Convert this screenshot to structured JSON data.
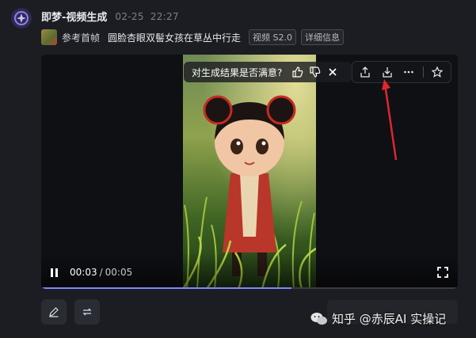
{
  "header": {
    "app_name": "即梦-视频生成",
    "date": "02-25",
    "time": "22:27"
  },
  "prompt": {
    "ref_label": "参考首帧",
    "text": "圆脸杏眼双髻女孩在草丛中行走",
    "model_tag": "视频 S2.0",
    "details_tag": "详细信息"
  },
  "player": {
    "current_time": "00:03",
    "separator": "/",
    "duration": "00:05",
    "progress": 0.6
  },
  "feedback": {
    "question": "对生成结果是否满意?"
  },
  "toolbar": {
    "icons": [
      "share-icon",
      "download-icon",
      "more-icon",
      "star-icon"
    ]
  },
  "bottom": {
    "icons": [
      "edit-icon",
      "regenerate-icon"
    ]
  },
  "watermark": {
    "text": "知乎 @赤辰AI 实操记"
  },
  "colors": {
    "background": "#1b1d22",
    "accent": "#7f86ff",
    "arrow": "#e0262d"
  }
}
